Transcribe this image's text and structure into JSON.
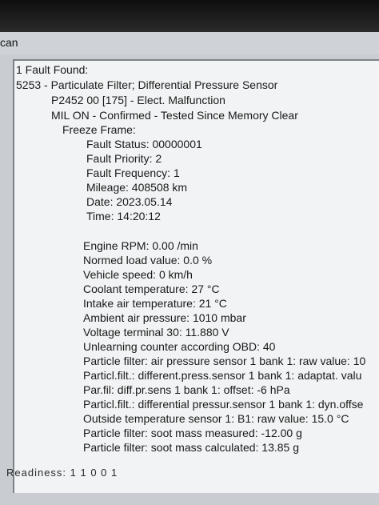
{
  "window": {
    "title_fragment": "can"
  },
  "report": {
    "fault_count": "1 Fault Found:",
    "fault_code_line": "5253 - Particulate Filter; Differential Pressure Sensor",
    "dtc_line": "P2452 00 [175] - Elect. Malfunction",
    "mil_line": "MIL ON - Confirmed - Tested Since Memory Clear",
    "freeze_frame": "Freeze Frame:",
    "fault_status": "Fault Status: 00000001",
    "fault_priority": "Fault Priority: 2",
    "fault_frequency": "Fault Frequency: 1",
    "mileage": "Mileage: 408508 km",
    "date": "Date: 2023.05.14",
    "time": "Time: 14:20:12",
    "engine_rpm": "Engine RPM: 0.00 /min",
    "normed_load": "Normed load value: 0.0 %",
    "vehicle_speed": "Vehicle speed: 0 km/h",
    "coolant_temp": "Coolant temperature: 27 °C",
    "intake_air_temp": "Intake air temperature: 21 °C",
    "ambient_pressure": "Ambient air pressure: 1010 mbar",
    "voltage_30": "Voltage terminal 30: 11.880 V",
    "unlearning_counter": "Unlearning counter according OBD: 40",
    "pf_air_pressure": "Particle filter: air pressure sensor 1 bank 1: raw value: 10",
    "pf_diff_adapt": "Particl.filt.: different.press.sensor 1 bank 1: adaptat. valu",
    "pf_diff_offset": "Par.fil: diff.pr.sens 1 bank 1: offset: -6 hPa",
    "pf_diff_dyn": "Particl.filt.: differential pressur.sensor 1 bank 1: dyn.offse",
    "outside_temp": "Outside temperature sensor 1: B1: raw value: 15.0 °C",
    "soot_measured": "Particle filter: soot mass measured: -12.00 g",
    "soot_calculated": "Particle filter: soot mass calculated: 13.85 g"
  },
  "readiness": "Readiness: 1 1 0 0 1"
}
